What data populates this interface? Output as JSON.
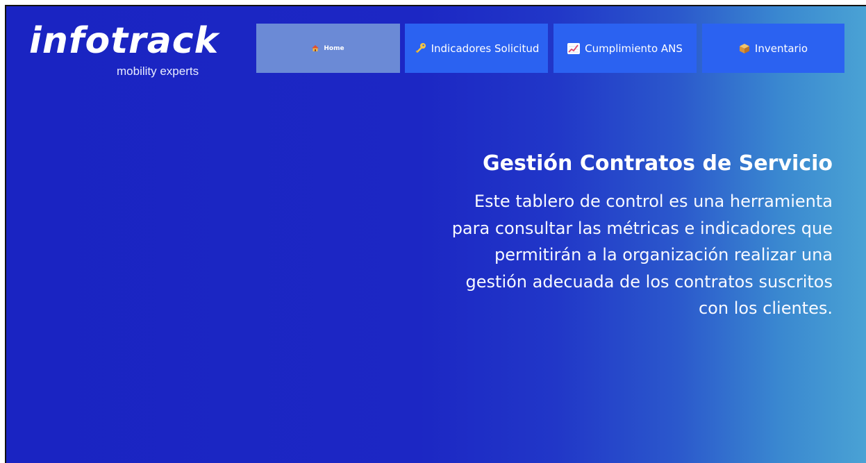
{
  "brand": {
    "name": "infotrack",
    "tagline": "mobility experts"
  },
  "nav": {
    "tabs": [
      {
        "label": "Home",
        "icon": "house-icon",
        "active": true
      },
      {
        "label": "Indicadores Solicitud",
        "icon": "key-icon",
        "active": false
      },
      {
        "label": "Cumplimiento ANS",
        "icon": "chart-increasing-icon",
        "active": false
      },
      {
        "label": "Inventario",
        "icon": "package-icon",
        "active": false
      }
    ]
  },
  "hero": {
    "title": "Gestión Contratos de Servicio",
    "lines": [
      "Este tablero de control es una herramienta",
      "para consultar las métricas e indicadores que",
      "permitirán a la organización realizar una",
      "gestión adecuada de los contratos suscritos",
      "con los clientes."
    ]
  },
  "colors": {
    "background_start": "#1a24c2",
    "background_end": "#4aa2d4",
    "tab_active": "#6b8ad6",
    "tab_normal": "#2b62f1"
  }
}
